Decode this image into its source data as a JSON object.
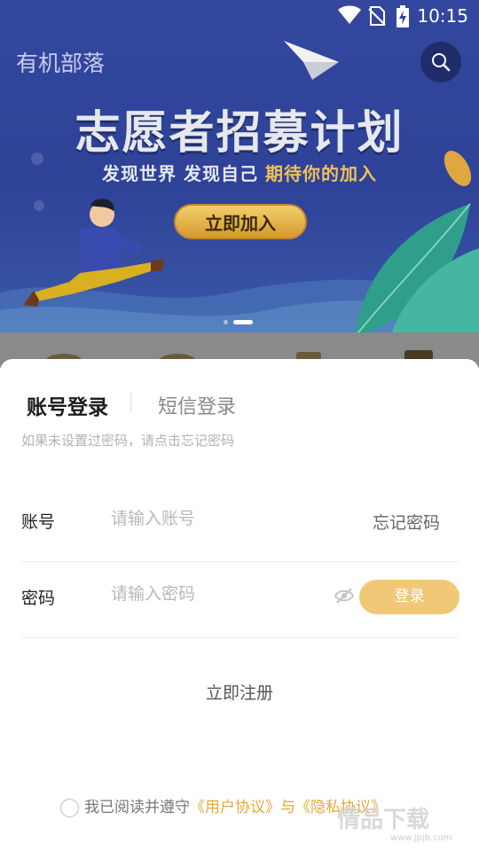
{
  "status_bar": {
    "time": "10:15",
    "icons": [
      "wifi-icon",
      "no-sim-icon",
      "battery-charging-icon"
    ]
  },
  "header": {
    "app_title": "有机部落",
    "search_icon": "search-icon"
  },
  "banner": {
    "headline": "志愿者招募计划",
    "subline_plain": "发现世界 发现自己",
    "subline_highlight": "期待你的加入",
    "cta_label": "立即加入",
    "colors": {
      "background": "#2e4298",
      "cta": "#f3cf6b",
      "highlight": "#f0c15c"
    }
  },
  "login": {
    "tab_account": "账号登录",
    "tab_sms": "短信登录",
    "hint": "如果未设置过密码，请点击忘记密码",
    "account_label": "账号",
    "account_placeholder": "请输入账号",
    "forgot_label": "忘记密码",
    "password_label": "密码",
    "password_placeholder": "请输入密码",
    "visibility_icon": "eye-off-icon",
    "login_button": "登录",
    "register_label": "立即注册",
    "agree_prefix": "我已阅读并遵守",
    "user_agreement": "《用户协议》",
    "agree_and": "与",
    "privacy_agreement": "《隐私协议》",
    "accent_color": "#f0c878"
  },
  "watermark": {
    "text": "情品下载",
    "sub": "www.jpjb.com"
  }
}
